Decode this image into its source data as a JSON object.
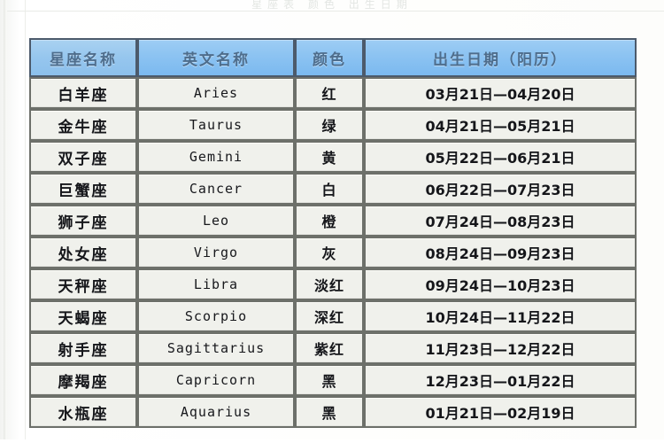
{
  "page": {
    "top_caption": "星座表 颜色 出生日期"
  },
  "table": {
    "caption_visible": false,
    "headers": [
      {
        "key": "name",
        "label": "星座名称"
      },
      {
        "key": "en",
        "label": "英文名称"
      },
      {
        "key": "color",
        "label": "颜色"
      },
      {
        "key": "date",
        "label": "出生日期（阳历）"
      }
    ],
    "header_bg": "#8cc3f2",
    "header_text_color": "#4e6d8c",
    "cell_bg": "#f0f1ec",
    "border_color": "#6d706a",
    "rows": [
      {
        "name": "白羊座",
        "en": "Aries",
        "color": "红",
        "date": "03月21日—04月20日"
      },
      {
        "name": "金牛座",
        "en": "Taurus",
        "color": "绿",
        "date": "04月21日—05月21日"
      },
      {
        "name": "双子座",
        "en": "Gemini",
        "color": "黄",
        "date": "05月22日—06月21日"
      },
      {
        "name": "巨蟹座",
        "en": "Cancer",
        "color": "白",
        "date": "06月22日—07月23日"
      },
      {
        "name": "狮子座",
        "en": "Leo",
        "color": "橙",
        "date": "07月24日—08月23日"
      },
      {
        "name": "处女座",
        "en": "Virgo",
        "color": "灰",
        "date": "08月24日—09月23日"
      },
      {
        "name": "天秤座",
        "en": "Libra",
        "color": "淡红",
        "date": "09月24日—10月23日"
      },
      {
        "name": "天蝎座",
        "en": "Scorpio",
        "color": "深红",
        "date": "10月24日—11月22日"
      },
      {
        "name": "射手座",
        "en": "Sagittarius",
        "color": "紫红",
        "date": "11月23日—12月22日"
      },
      {
        "name": "摩羯座",
        "en": "Capricorn",
        "color": "黑",
        "date": "12月23日—01月22日"
      },
      {
        "name": "水瓶座",
        "en": "Aquarius",
        "color": "黑",
        "date": "01月21日—02月19日"
      }
    ]
  }
}
